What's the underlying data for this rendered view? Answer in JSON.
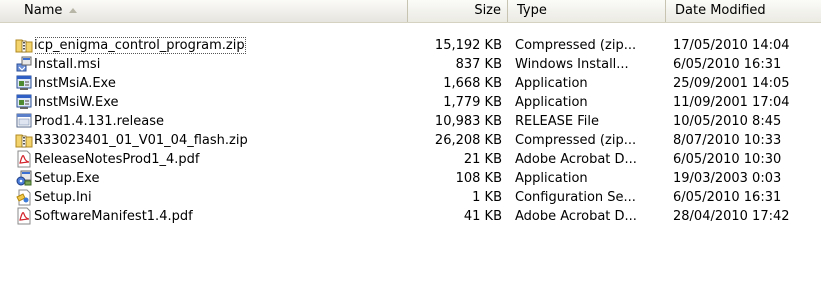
{
  "columns": {
    "name": "Name",
    "size": "Size",
    "type": "Type",
    "date": "Date Modified"
  },
  "files": [
    {
      "name": "icp_enigma_control_program.zip",
      "size": "15,192 KB",
      "type": "Compressed (zip...",
      "date": "17/05/2010 14:04",
      "icon": "zip-folder-icon"
    },
    {
      "name": "Install.msi",
      "size": "837 KB",
      "type": "Windows Install...",
      "date": "6/05/2010 16:31",
      "icon": "msi-installer-icon"
    },
    {
      "name": "InstMsiA.Exe",
      "size": "1,668 KB",
      "type": "Application",
      "date": "25/09/2001 14:05",
      "icon": "application-icon"
    },
    {
      "name": "InstMsiW.Exe",
      "size": "1,779 KB",
      "type": "Application",
      "date": "11/09/2001 17:04",
      "icon": "application-icon"
    },
    {
      "name": "Prod1.4.131.release",
      "size": "10,983 KB",
      "type": "RELEASE File",
      "date": "10/05/2010 8:45",
      "icon": "generic-file-icon"
    },
    {
      "name": "R33023401_01_V01_04_flash.zip",
      "size": "26,208 KB",
      "type": "Compressed (zip...",
      "date": "8/07/2010 10:33",
      "icon": "zip-folder-icon"
    },
    {
      "name": "ReleaseNotesProd1_4.pdf",
      "size": "21 KB",
      "type": "Adobe Acrobat D...",
      "date": "6/05/2010 10:30",
      "icon": "pdf-icon"
    },
    {
      "name": "Setup.Exe",
      "size": "108 KB",
      "type": "Application",
      "date": "19/03/2003 0:03",
      "icon": "setup-icon"
    },
    {
      "name": "Setup.Ini",
      "size": "1 KB",
      "type": "Configuration Se...",
      "date": "6/05/2010 16:31",
      "icon": "config-file-icon"
    },
    {
      "name": "SoftwareManifest1.4.pdf",
      "size": "41 KB",
      "type": "Adobe Acrobat D...",
      "date": "28/04/2010 17:42",
      "icon": "pdf-icon"
    }
  ],
  "sort": {
    "column": "name",
    "direction": "ascending"
  }
}
